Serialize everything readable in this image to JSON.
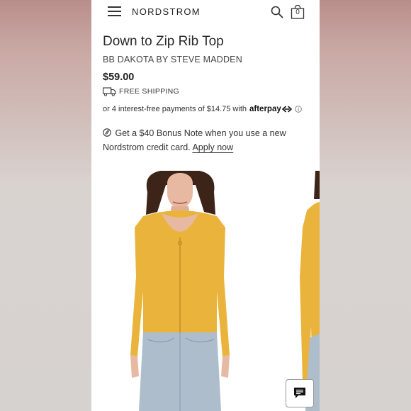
{
  "header": {
    "brand": "NORDSTROM",
    "bag_count": "0",
    "icons": [
      "menu-icon",
      "search-icon",
      "shopping-bag-icon"
    ]
  },
  "product": {
    "title": "Down to Zip Rib Top",
    "brand": "BB DAKOTA BY STEVE MADDEN",
    "price": "$59.00",
    "shipping": "FREE SHIPPING",
    "afterpay_text": "or 4 interest-free payments of $14.75 with",
    "afterpay_brand": "afterpay",
    "bonus_text": "Get a $40 Bonus Note when you use a new Nordstrom credit card.",
    "apply_link": "Apply now"
  },
  "colors": {
    "sweater": "#eab43c",
    "denim": "#aebdcc",
    "accent_text": "#222222"
  },
  "chat": {
    "icon": "chat-icon"
  }
}
